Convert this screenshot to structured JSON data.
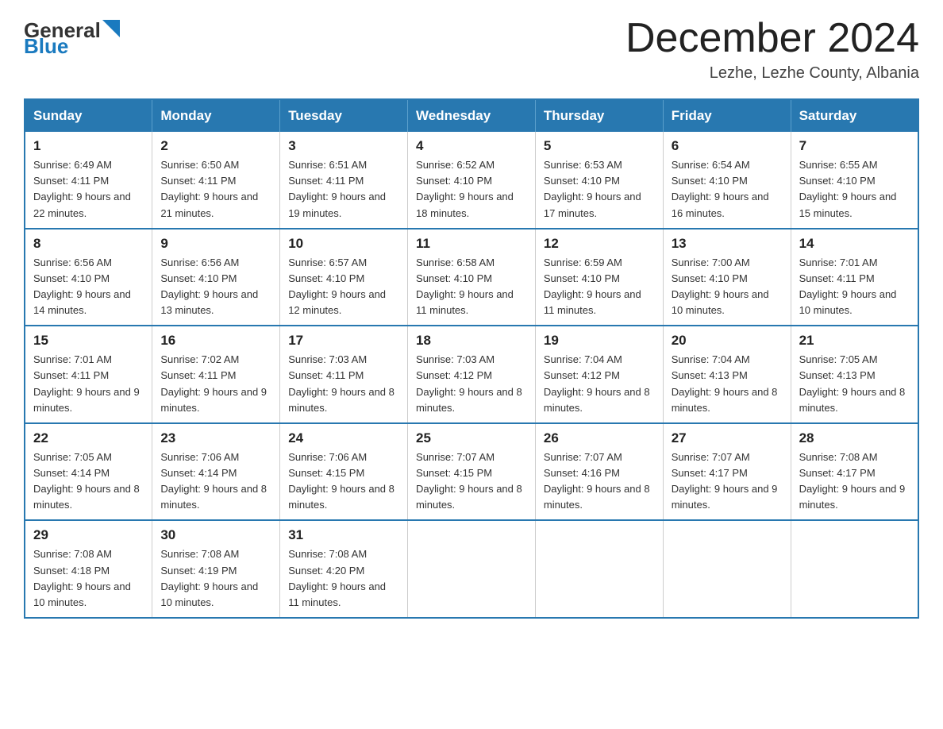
{
  "header": {
    "logo_general": "General",
    "logo_blue": "Blue",
    "title": "December 2024",
    "location": "Lezhe, Lezhe County, Albania"
  },
  "calendar": {
    "days_of_week": [
      "Sunday",
      "Monday",
      "Tuesday",
      "Wednesday",
      "Thursday",
      "Friday",
      "Saturday"
    ],
    "weeks": [
      [
        {
          "day": "1",
          "sunrise": "Sunrise: 6:49 AM",
          "sunset": "Sunset: 4:11 PM",
          "daylight": "Daylight: 9 hours and 22 minutes."
        },
        {
          "day": "2",
          "sunrise": "Sunrise: 6:50 AM",
          "sunset": "Sunset: 4:11 PM",
          "daylight": "Daylight: 9 hours and 21 minutes."
        },
        {
          "day": "3",
          "sunrise": "Sunrise: 6:51 AM",
          "sunset": "Sunset: 4:11 PM",
          "daylight": "Daylight: 9 hours and 19 minutes."
        },
        {
          "day": "4",
          "sunrise": "Sunrise: 6:52 AM",
          "sunset": "Sunset: 4:10 PM",
          "daylight": "Daylight: 9 hours and 18 minutes."
        },
        {
          "day": "5",
          "sunrise": "Sunrise: 6:53 AM",
          "sunset": "Sunset: 4:10 PM",
          "daylight": "Daylight: 9 hours and 17 minutes."
        },
        {
          "day": "6",
          "sunrise": "Sunrise: 6:54 AM",
          "sunset": "Sunset: 4:10 PM",
          "daylight": "Daylight: 9 hours and 16 minutes."
        },
        {
          "day": "7",
          "sunrise": "Sunrise: 6:55 AM",
          "sunset": "Sunset: 4:10 PM",
          "daylight": "Daylight: 9 hours and 15 minutes."
        }
      ],
      [
        {
          "day": "8",
          "sunrise": "Sunrise: 6:56 AM",
          "sunset": "Sunset: 4:10 PM",
          "daylight": "Daylight: 9 hours and 14 minutes."
        },
        {
          "day": "9",
          "sunrise": "Sunrise: 6:56 AM",
          "sunset": "Sunset: 4:10 PM",
          "daylight": "Daylight: 9 hours and 13 minutes."
        },
        {
          "day": "10",
          "sunrise": "Sunrise: 6:57 AM",
          "sunset": "Sunset: 4:10 PM",
          "daylight": "Daylight: 9 hours and 12 minutes."
        },
        {
          "day": "11",
          "sunrise": "Sunrise: 6:58 AM",
          "sunset": "Sunset: 4:10 PM",
          "daylight": "Daylight: 9 hours and 11 minutes."
        },
        {
          "day": "12",
          "sunrise": "Sunrise: 6:59 AM",
          "sunset": "Sunset: 4:10 PM",
          "daylight": "Daylight: 9 hours and 11 minutes."
        },
        {
          "day": "13",
          "sunrise": "Sunrise: 7:00 AM",
          "sunset": "Sunset: 4:10 PM",
          "daylight": "Daylight: 9 hours and 10 minutes."
        },
        {
          "day": "14",
          "sunrise": "Sunrise: 7:01 AM",
          "sunset": "Sunset: 4:11 PM",
          "daylight": "Daylight: 9 hours and 10 minutes."
        }
      ],
      [
        {
          "day": "15",
          "sunrise": "Sunrise: 7:01 AM",
          "sunset": "Sunset: 4:11 PM",
          "daylight": "Daylight: 9 hours and 9 minutes."
        },
        {
          "day": "16",
          "sunrise": "Sunrise: 7:02 AM",
          "sunset": "Sunset: 4:11 PM",
          "daylight": "Daylight: 9 hours and 9 minutes."
        },
        {
          "day": "17",
          "sunrise": "Sunrise: 7:03 AM",
          "sunset": "Sunset: 4:11 PM",
          "daylight": "Daylight: 9 hours and 8 minutes."
        },
        {
          "day": "18",
          "sunrise": "Sunrise: 7:03 AM",
          "sunset": "Sunset: 4:12 PM",
          "daylight": "Daylight: 9 hours and 8 minutes."
        },
        {
          "day": "19",
          "sunrise": "Sunrise: 7:04 AM",
          "sunset": "Sunset: 4:12 PM",
          "daylight": "Daylight: 9 hours and 8 minutes."
        },
        {
          "day": "20",
          "sunrise": "Sunrise: 7:04 AM",
          "sunset": "Sunset: 4:13 PM",
          "daylight": "Daylight: 9 hours and 8 minutes."
        },
        {
          "day": "21",
          "sunrise": "Sunrise: 7:05 AM",
          "sunset": "Sunset: 4:13 PM",
          "daylight": "Daylight: 9 hours and 8 minutes."
        }
      ],
      [
        {
          "day": "22",
          "sunrise": "Sunrise: 7:05 AM",
          "sunset": "Sunset: 4:14 PM",
          "daylight": "Daylight: 9 hours and 8 minutes."
        },
        {
          "day": "23",
          "sunrise": "Sunrise: 7:06 AM",
          "sunset": "Sunset: 4:14 PM",
          "daylight": "Daylight: 9 hours and 8 minutes."
        },
        {
          "day": "24",
          "sunrise": "Sunrise: 7:06 AM",
          "sunset": "Sunset: 4:15 PM",
          "daylight": "Daylight: 9 hours and 8 minutes."
        },
        {
          "day": "25",
          "sunrise": "Sunrise: 7:07 AM",
          "sunset": "Sunset: 4:15 PM",
          "daylight": "Daylight: 9 hours and 8 minutes."
        },
        {
          "day": "26",
          "sunrise": "Sunrise: 7:07 AM",
          "sunset": "Sunset: 4:16 PM",
          "daylight": "Daylight: 9 hours and 8 minutes."
        },
        {
          "day": "27",
          "sunrise": "Sunrise: 7:07 AM",
          "sunset": "Sunset: 4:17 PM",
          "daylight": "Daylight: 9 hours and 9 minutes."
        },
        {
          "day": "28",
          "sunrise": "Sunrise: 7:08 AM",
          "sunset": "Sunset: 4:17 PM",
          "daylight": "Daylight: 9 hours and 9 minutes."
        }
      ],
      [
        {
          "day": "29",
          "sunrise": "Sunrise: 7:08 AM",
          "sunset": "Sunset: 4:18 PM",
          "daylight": "Daylight: 9 hours and 10 minutes."
        },
        {
          "day": "30",
          "sunrise": "Sunrise: 7:08 AM",
          "sunset": "Sunset: 4:19 PM",
          "daylight": "Daylight: 9 hours and 10 minutes."
        },
        {
          "day": "31",
          "sunrise": "Sunrise: 7:08 AM",
          "sunset": "Sunset: 4:20 PM",
          "daylight": "Daylight: 9 hours and 11 minutes."
        },
        null,
        null,
        null,
        null
      ]
    ]
  }
}
